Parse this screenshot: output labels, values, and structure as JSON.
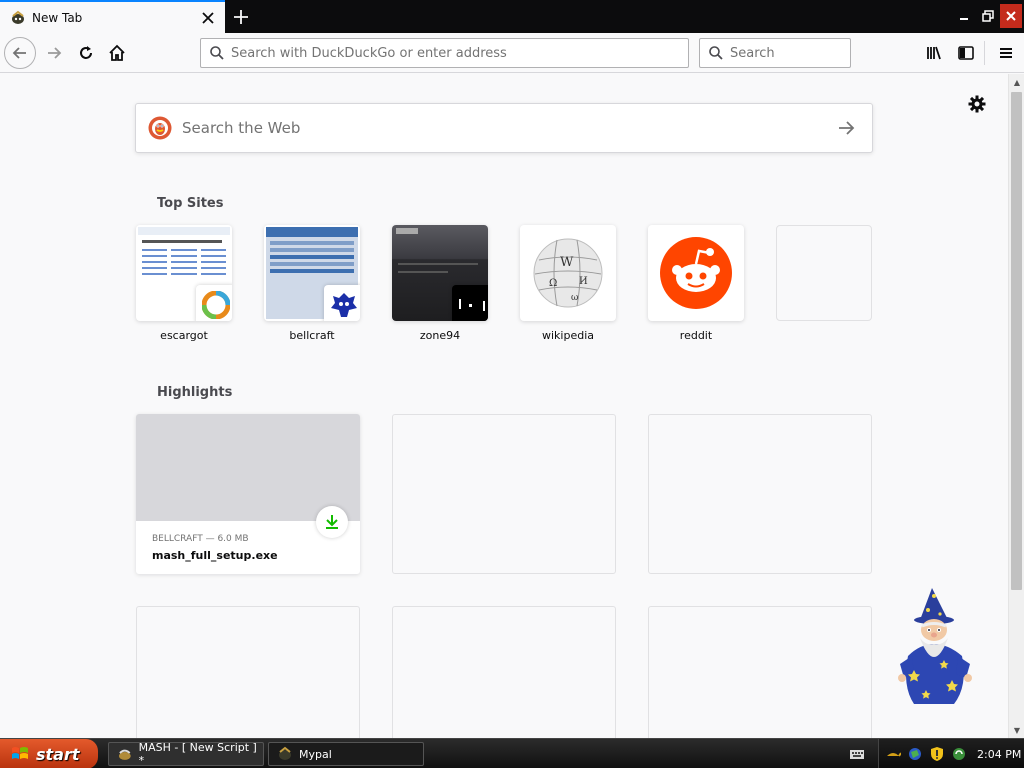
{
  "browser": {
    "tab": {
      "title": "New Tab",
      "close_icon": "close-icon"
    },
    "new_tab_icon": "plus-icon",
    "urlbar_placeholder": "Search with DuckDuckGo or enter address",
    "searchbar_placeholder": "Search"
  },
  "newtab": {
    "search_placeholder": "Search the Web",
    "top_sites_title": "Top Sites",
    "top_sites": [
      {
        "label": "escargot"
      },
      {
        "label": "bellcraft"
      },
      {
        "label": "zone94"
      },
      {
        "label": "wikipedia"
      },
      {
        "label": "reddit"
      },
      {
        "label": ""
      }
    ],
    "highlights_title": "Highlights",
    "highlight": {
      "meta": "BELLCRAFT — 6.0 MB",
      "filename": "mash_full_setup.exe"
    }
  },
  "taskbar": {
    "start_label": "start",
    "items": [
      {
        "label": "MASH - [ New Script ] *"
      },
      {
        "label": "Mypal"
      }
    ],
    "clock": "2:04 PM"
  },
  "colors": {
    "accent": "#0a84ff",
    "reddit": "#ff4500",
    "download_green": "#12bc00",
    "start_button": "#d9471b"
  }
}
